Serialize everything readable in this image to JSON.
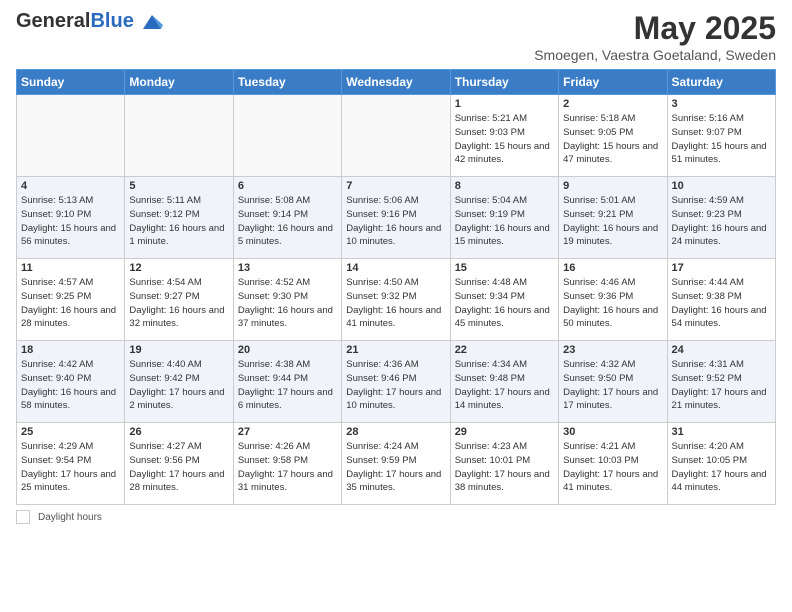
{
  "header": {
    "logo_general": "General",
    "logo_blue": "Blue",
    "month": "May 2025",
    "location": "Smoegen, Vaestra Goetaland, Sweden"
  },
  "days_of_week": [
    "Sunday",
    "Monday",
    "Tuesday",
    "Wednesday",
    "Thursday",
    "Friday",
    "Saturday"
  ],
  "footer": {
    "label": "Daylight hours"
  },
  "weeks": [
    [
      {
        "day": "",
        "info": ""
      },
      {
        "day": "",
        "info": ""
      },
      {
        "day": "",
        "info": ""
      },
      {
        "day": "",
        "info": ""
      },
      {
        "day": "1",
        "info": "Sunrise: 5:21 AM\nSunset: 9:03 PM\nDaylight: 15 hours\nand 42 minutes."
      },
      {
        "day": "2",
        "info": "Sunrise: 5:18 AM\nSunset: 9:05 PM\nDaylight: 15 hours\nand 47 minutes."
      },
      {
        "day": "3",
        "info": "Sunrise: 5:16 AM\nSunset: 9:07 PM\nDaylight: 15 hours\nand 51 minutes."
      }
    ],
    [
      {
        "day": "4",
        "info": "Sunrise: 5:13 AM\nSunset: 9:10 PM\nDaylight: 15 hours\nand 56 minutes."
      },
      {
        "day": "5",
        "info": "Sunrise: 5:11 AM\nSunset: 9:12 PM\nDaylight: 16 hours\nand 1 minute."
      },
      {
        "day": "6",
        "info": "Sunrise: 5:08 AM\nSunset: 9:14 PM\nDaylight: 16 hours\nand 5 minutes."
      },
      {
        "day": "7",
        "info": "Sunrise: 5:06 AM\nSunset: 9:16 PM\nDaylight: 16 hours\nand 10 minutes."
      },
      {
        "day": "8",
        "info": "Sunrise: 5:04 AM\nSunset: 9:19 PM\nDaylight: 16 hours\nand 15 minutes."
      },
      {
        "day": "9",
        "info": "Sunrise: 5:01 AM\nSunset: 9:21 PM\nDaylight: 16 hours\nand 19 minutes."
      },
      {
        "day": "10",
        "info": "Sunrise: 4:59 AM\nSunset: 9:23 PM\nDaylight: 16 hours\nand 24 minutes."
      }
    ],
    [
      {
        "day": "11",
        "info": "Sunrise: 4:57 AM\nSunset: 9:25 PM\nDaylight: 16 hours\nand 28 minutes."
      },
      {
        "day": "12",
        "info": "Sunrise: 4:54 AM\nSunset: 9:27 PM\nDaylight: 16 hours\nand 32 minutes."
      },
      {
        "day": "13",
        "info": "Sunrise: 4:52 AM\nSunset: 9:30 PM\nDaylight: 16 hours\nand 37 minutes."
      },
      {
        "day": "14",
        "info": "Sunrise: 4:50 AM\nSunset: 9:32 PM\nDaylight: 16 hours\nand 41 minutes."
      },
      {
        "day": "15",
        "info": "Sunrise: 4:48 AM\nSunset: 9:34 PM\nDaylight: 16 hours\nand 45 minutes."
      },
      {
        "day": "16",
        "info": "Sunrise: 4:46 AM\nSunset: 9:36 PM\nDaylight: 16 hours\nand 50 minutes."
      },
      {
        "day": "17",
        "info": "Sunrise: 4:44 AM\nSunset: 9:38 PM\nDaylight: 16 hours\nand 54 minutes."
      }
    ],
    [
      {
        "day": "18",
        "info": "Sunrise: 4:42 AM\nSunset: 9:40 PM\nDaylight: 16 hours\nand 58 minutes."
      },
      {
        "day": "19",
        "info": "Sunrise: 4:40 AM\nSunset: 9:42 PM\nDaylight: 17 hours\nand 2 minutes."
      },
      {
        "day": "20",
        "info": "Sunrise: 4:38 AM\nSunset: 9:44 PM\nDaylight: 17 hours\nand 6 minutes."
      },
      {
        "day": "21",
        "info": "Sunrise: 4:36 AM\nSunset: 9:46 PM\nDaylight: 17 hours\nand 10 minutes."
      },
      {
        "day": "22",
        "info": "Sunrise: 4:34 AM\nSunset: 9:48 PM\nDaylight: 17 hours\nand 14 minutes."
      },
      {
        "day": "23",
        "info": "Sunrise: 4:32 AM\nSunset: 9:50 PM\nDaylight: 17 hours\nand 17 minutes."
      },
      {
        "day": "24",
        "info": "Sunrise: 4:31 AM\nSunset: 9:52 PM\nDaylight: 17 hours\nand 21 minutes."
      }
    ],
    [
      {
        "day": "25",
        "info": "Sunrise: 4:29 AM\nSunset: 9:54 PM\nDaylight: 17 hours\nand 25 minutes."
      },
      {
        "day": "26",
        "info": "Sunrise: 4:27 AM\nSunset: 9:56 PM\nDaylight: 17 hours\nand 28 minutes."
      },
      {
        "day": "27",
        "info": "Sunrise: 4:26 AM\nSunset: 9:58 PM\nDaylight: 17 hours\nand 31 minutes."
      },
      {
        "day": "28",
        "info": "Sunrise: 4:24 AM\nSunset: 9:59 PM\nDaylight: 17 hours\nand 35 minutes."
      },
      {
        "day": "29",
        "info": "Sunrise: 4:23 AM\nSunset: 10:01 PM\nDaylight: 17 hours\nand 38 minutes."
      },
      {
        "day": "30",
        "info": "Sunrise: 4:21 AM\nSunset: 10:03 PM\nDaylight: 17 hours\nand 41 minutes."
      },
      {
        "day": "31",
        "info": "Sunrise: 4:20 AM\nSunset: 10:05 PM\nDaylight: 17 hours\nand 44 minutes."
      }
    ]
  ]
}
